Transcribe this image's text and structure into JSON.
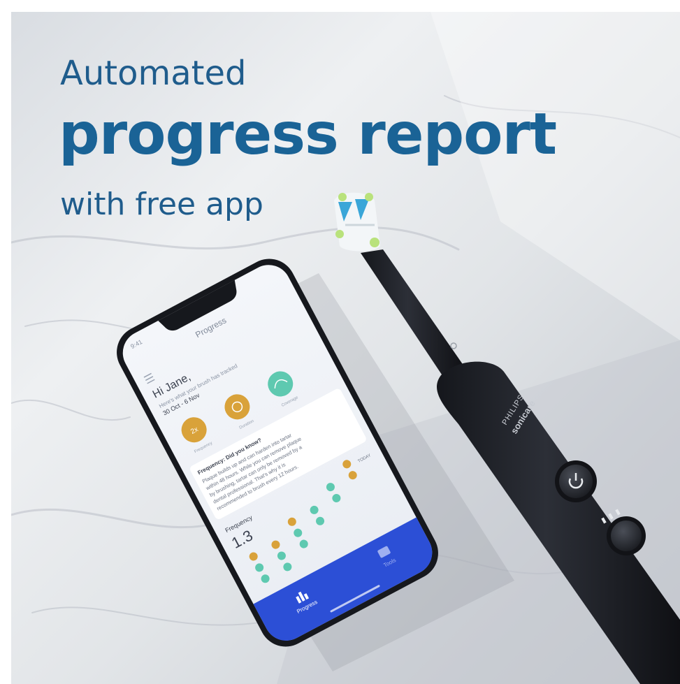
{
  "headline": {
    "line1": "Automated",
    "line2": "progress report",
    "line3": "with free app"
  },
  "phone": {
    "status_time": "9:41",
    "screen_title": "Progress",
    "greeting": "Hi Jane,",
    "intro": "Here's what your brush has tracked",
    "date_range": "30 Oct - 6 Nov",
    "badges": [
      "2x",
      "",
      ""
    ],
    "badge_labels": [
      "Frequency",
      "Duration",
      "Coverage"
    ],
    "tip_title": "Frequency: Did you know?",
    "tip_lines": [
      "Plaque builds up and can harden into tartar",
      "within 48 hours. While you can remove plaque",
      "by brushing, tartar can only be removed by a",
      "dental professional. That's why it is",
      "recommended to brush every 12 hours."
    ],
    "freq_label": "Frequency",
    "freq_value": "1.3",
    "today_label": "TODAY",
    "nav_progress": "Progress",
    "nav_tools": "Tools"
  },
  "toothbrush": {
    "brand": "PHILIPS",
    "model": "sonicare"
  },
  "colors": {
    "headline": "#1a6396",
    "accent_gold": "#d9a23a",
    "accent_teal": "#5ec9b0",
    "nav_blue": "#2c4fd6"
  }
}
